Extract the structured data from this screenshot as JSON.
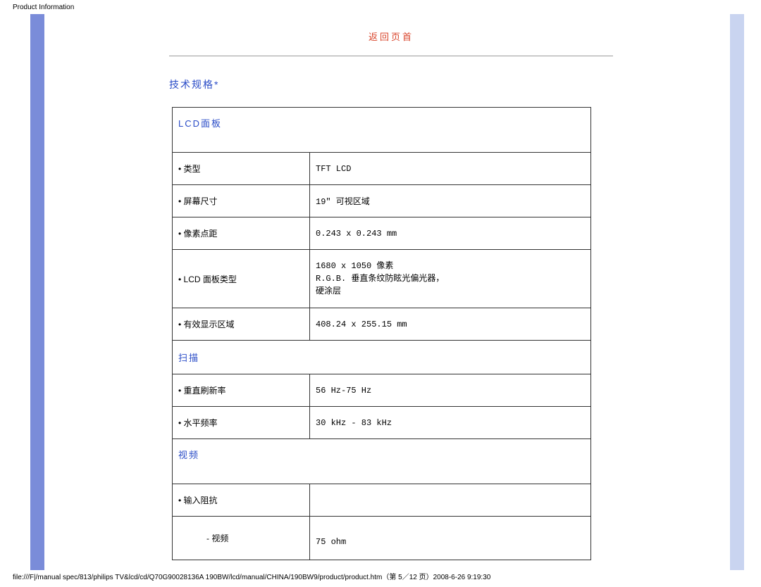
{
  "header": "Product Information",
  "back_to_top": "返回页首",
  "section_title": "技术规格*",
  "lcd_panel": {
    "title": "LCD面板",
    "rows": [
      {
        "label": "• 类型",
        "value": "TFT LCD"
      },
      {
        "label": "• 屏幕尺寸",
        "value": "19\" 可视区域"
      },
      {
        "label": "• 像素点距",
        "value": "0.243 x 0.243 mm"
      },
      {
        "label": "• LCD 面板类型",
        "value": "1680 x 1050 像素\nR.G.B. 垂直条纹防眩光偏光器，\n硬涂层"
      },
      {
        "label": "• 有效显示区域",
        "value": "408.24 x 255.15 mm"
      }
    ]
  },
  "scanning": {
    "title": "扫描",
    "rows": [
      {
        "label": "• 重直刷新率",
        "value": "56 Hz-75 Hz"
      },
      {
        "label": "• 水平频率",
        "value": "30 kHz - 83 kHz"
      }
    ]
  },
  "video": {
    "title": "视频",
    "input_impedance": "• 输入阻抗",
    "video_sub": "- 视频",
    "video_value": "75 ohm"
  },
  "footer": "file:///F|/manual spec/813/philips TV&lcd/cd/Q70G90028136A 190BW/lcd/manual/CHINA/190BW9/product/product.htm（第 5／12 页）2008-6-26 9:19:30"
}
